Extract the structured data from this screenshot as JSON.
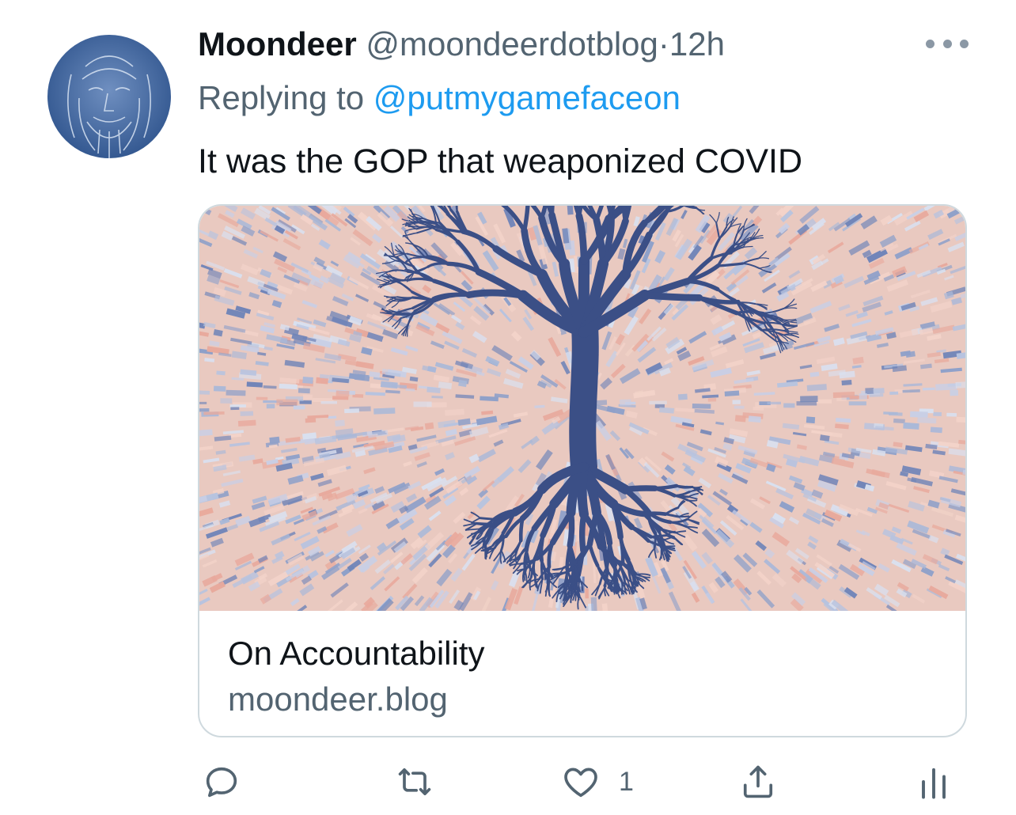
{
  "tweet": {
    "display_name": "Moondeer",
    "handle": "@moondeerdotblog",
    "separator": "·",
    "time": "12h",
    "replying_prefix": "Replying to ",
    "replying_to": "@putmygameface​on",
    "text": "It was the GOP that weaponized COVID"
  },
  "card": {
    "title": "On Accountability",
    "domain": "moondeer.blog"
  },
  "actions": {
    "like_count": "1"
  },
  "icons": {
    "avatar": "bearded-man-sketch-avatar",
    "more": "more-horizontal-icon",
    "reply": "reply-icon",
    "retweet": "retweet-icon",
    "like": "heart-icon",
    "share": "share-icon",
    "analytics": "analytics-icon"
  },
  "colors": {
    "text": "#0f1419",
    "secondary": "#536471",
    "link": "#1d9bf0",
    "border": "#cfd9de",
    "tree": "#3b4f86",
    "image_pink": "#e9b7ad",
    "image_blue": "#8ea0c9"
  }
}
